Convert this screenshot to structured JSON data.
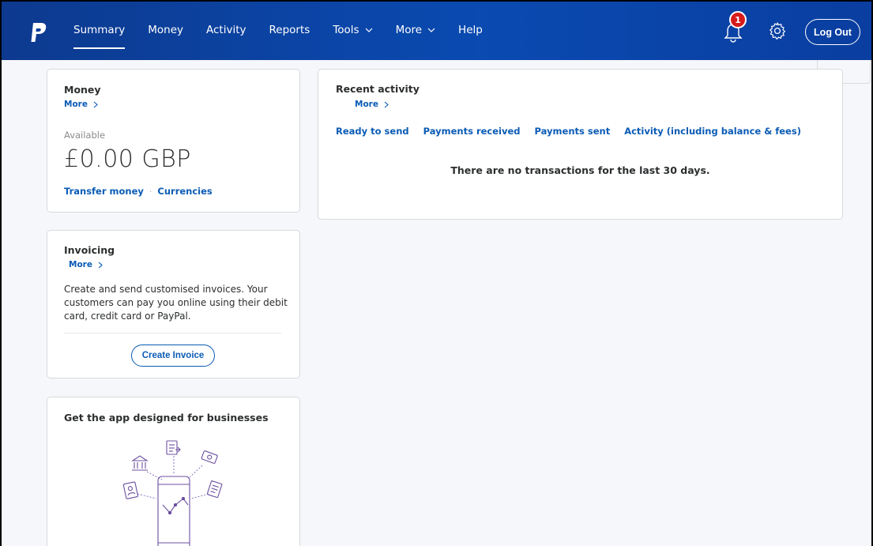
{
  "header": {
    "nav": [
      {
        "label": "Summary",
        "active": true
      },
      {
        "label": "Money"
      },
      {
        "label": "Activity"
      },
      {
        "label": "Reports"
      },
      {
        "label": "Tools",
        "dropdown": true
      },
      {
        "label": "More",
        "dropdown": true
      },
      {
        "label": "Help"
      }
    ],
    "notification_count": "1",
    "logout_label": "Log Out",
    "icons": [
      "paypal-logo",
      "bell-icon",
      "gear-icon"
    ],
    "colors": {
      "bar_start": "#0d3a8f",
      "bar_end": "#0a4ab1",
      "badge": "#d71b1b"
    }
  },
  "money_card": {
    "title": "Money",
    "more_label": "More",
    "available_label": "Available",
    "balance": "£0.00 GBP",
    "links": {
      "transfer": "Transfer money",
      "separator": "·",
      "currencies": "Currencies"
    }
  },
  "invoicing_card": {
    "title": "Invoicing",
    "more_label": "More",
    "description": "Create and send customised invoices. Your customers can pay you online using their debit card, credit card or PayPal.",
    "button_label": "Create Invoice"
  },
  "app_card": {
    "title": "Get the app designed for businesses",
    "icons": [
      "bank-icon",
      "invoice-icon",
      "cash-icon",
      "contact-card-icon",
      "receipt-icon",
      "phone-chart-icon"
    ]
  },
  "activity_card": {
    "title": "Recent activity",
    "more_label": "More",
    "tabs": [
      "Ready to send",
      "Payments received",
      "Payments sent",
      "Activity (including balance & fees)"
    ],
    "empty_message": "There are no transactions for the last 30 days."
  },
  "accent_color": "#0a5bb5"
}
